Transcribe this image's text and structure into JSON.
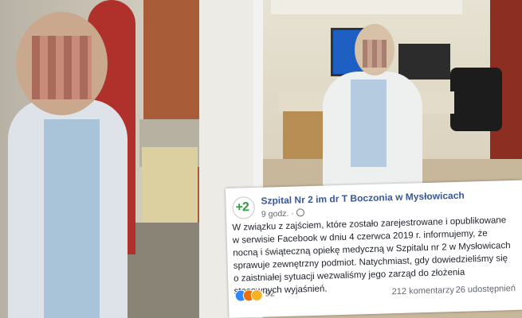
{
  "post": {
    "page_name": "Szpital Nr 2 im dr T Boczonia w Mysłowicach",
    "time": "9 godz. ·",
    "logo_text": "+2",
    "text": "W związku z zajściem, które zostało zarejestrowane i opublikowane w serwisie Facebook w dniu 4 czerwca 2019 r. informujemy, że nocną i świąteczną opiekę medyczną w Szpitalu nr 2 w Mysłowicach sprawuje zewnętrzny podmiot. Natychmiast, gdy dowiedzieliśmy się o zaistniałej sytuacji wezwaliśmy jego zarząd do złożenia stosownych wyjaśnień.",
    "reaction_count": "92",
    "comments": "212 komentarzy",
    "shares": "26 udostępnień",
    "reaction_icons": [
      "like-icon",
      "angry-icon",
      "haha-icon"
    ]
  },
  "colors": {
    "page_name": "#385898",
    "logo_green": "#2f9e3f",
    "meta_gray": "#616770"
  }
}
